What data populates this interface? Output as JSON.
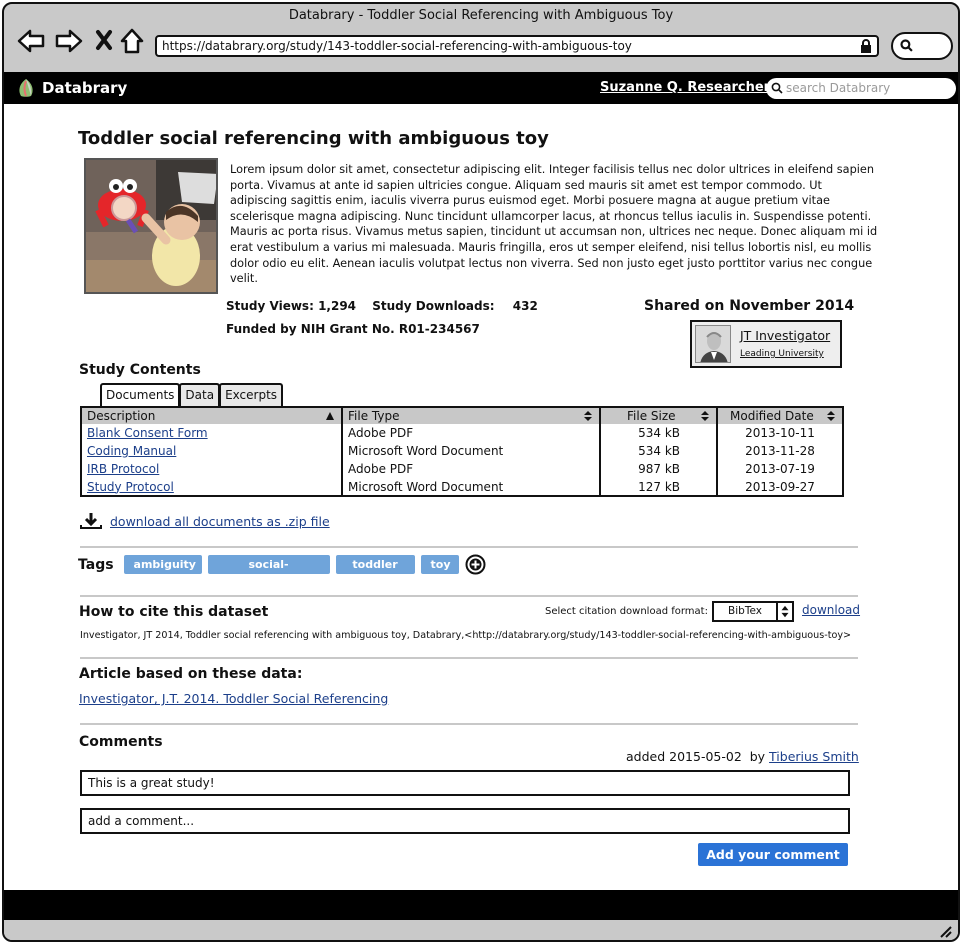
{
  "window": {
    "title": "Databrary - Toddler Social Referencing with Ambiguous Toy",
    "url": "https://databrary.org/study/143-toddler-social-referencing-with-ambiguous-toy"
  },
  "appbar": {
    "brand": "Databrary",
    "user": "Suzanne Q. Researcher",
    "search_placeholder": "search Databrary"
  },
  "study": {
    "title": "Toddler social referencing with ambiguous toy",
    "abstract": "Lorem ipsum dolor sit amet, consectetur adipiscing elit. Integer facilisis tellus nec dolor ultrices in eleifend sapien porta. Vivamus at ante id sapien ultricies congue. Aliquam sed mauris sit amet est tempor commodo. Ut adipiscing sagittis enim, iaculis viverra purus euismod eget. Morbi posuere magna at augue pretium vitae scelerisque magna adipiscing. Nunc tincidunt ullamcorper lacus, at rhoncus tellus iaculis in. Suspendisse potenti. Mauris ac porta risus. Vivamus metus sapien, tincidunt ut accumsan non, ultrices nec neque. Donec aliquam mi id erat vestibulum a varius mi malesuada. Mauris fringilla, eros ut semper eleifend, nisi tellus lobortis nisl, eu mollis dolor odio eu elit. Aenean iaculis volutpat lectus non viverra. Sed non justo eget justo porttitor varius nec congue velit.",
    "views_label": "Study Views:",
    "views": "1,294",
    "downloads_label": "Study Downloads:",
    "downloads": "432",
    "funding": "Funded by NIH Grant No. R01-234567",
    "shared": "Shared on November 2014",
    "investigator_name": "JT Investigator",
    "investigator_university": "Leading University"
  },
  "contents": {
    "title": "Study Contents",
    "tabs": [
      "Documents",
      "Data",
      "Excerpts"
    ],
    "columns": [
      "Description",
      "File Type",
      "File Size",
      "Modified Date"
    ],
    "rows": [
      {
        "description": "Blank Consent Form",
        "type": "Adobe PDF",
        "size": "534 kB",
        "date": "2013-10-11"
      },
      {
        "description": "Coding Manual",
        "type": "Microsoft Word Document",
        "size": "534 kB",
        "date": "2013-11-28"
      },
      {
        "description": "IRB Protocol",
        "type": "Adobe PDF",
        "size": "987 kB",
        "date": "2013-07-19"
      },
      {
        "description": "Study Protocol",
        "type": "Microsoft Word Document",
        "size": "127 kB",
        "date": "2013-09-27"
      }
    ],
    "download_all": "download all documents as .zip file"
  },
  "tags": {
    "label": "Tags",
    "items": [
      "ambiguity",
      "social-referencing",
      "toddler",
      "toy"
    ]
  },
  "citation": {
    "title": "How to cite this dataset",
    "format_label": "Select citation download format:",
    "format_value": "BibTex",
    "download_label": "download",
    "text": "Investigator, JT 2014, Toddler social referencing with ambiguous toy, Databrary,<http://databrary.org/study/143-toddler-social-referencing-with-ambiguous-toy>"
  },
  "article": {
    "title": "Article based on these data:",
    "link": "Investigator, J.T. 2014. Toddler Social Referencing"
  },
  "comments": {
    "title": "Comments",
    "added_prefix": "added 2015-05-02  by",
    "author": "Tiberius Smith",
    "existing": "This is a great study!",
    "placeholder": "add a comment...",
    "submit": "Add your comment"
  },
  "colors": {
    "tag": "#6fa4da",
    "button": "#2b73d6",
    "link": "#1c3f8a"
  }
}
